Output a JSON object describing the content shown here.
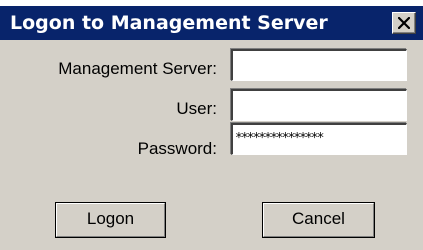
{
  "window": {
    "title": "Logon to Management Server",
    "close_icon": "close-icon"
  },
  "form": {
    "server_label": "Management Server:",
    "server_value": "",
    "user_label": "User:",
    "user_value": "",
    "password_label": "Password:",
    "password_value": "***************"
  },
  "buttons": {
    "logon_label": "Logon",
    "cancel_label": "Cancel"
  },
  "colors": {
    "titlebar": "#08246b",
    "dialog_face": "#d4d0c8"
  }
}
